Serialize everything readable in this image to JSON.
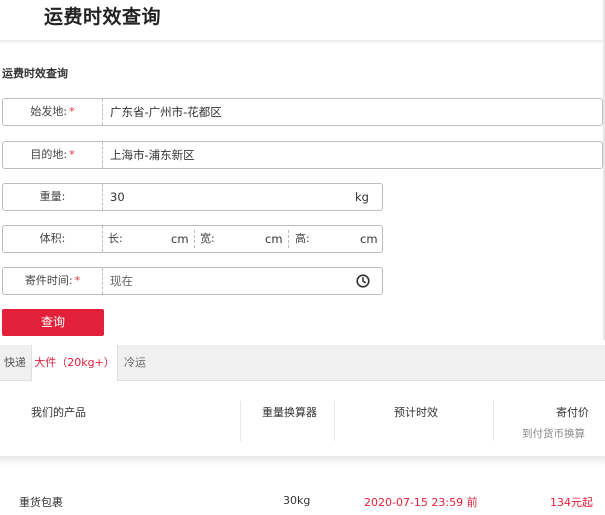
{
  "page": {
    "title": "运费时效查询"
  },
  "form": {
    "section_title": "运费时效查询",
    "origin": {
      "label": "始发地:",
      "required_mark": "*",
      "value": "广东省-广州市-花都区"
    },
    "destination": {
      "label": "目的地:",
      "required_mark": "*",
      "value": "上海市-浦东新区"
    },
    "weight": {
      "label": "重量:",
      "value": "30",
      "unit": "kg"
    },
    "volume": {
      "label": "体积:",
      "length_label": "长:",
      "length_unit": "cm",
      "width_label": "宽:",
      "width_unit": "cm",
      "height_label": "高:",
      "height_unit": "cm"
    },
    "send_time": {
      "label": "寄件时间:",
      "required_mark": "*",
      "value": "现在",
      "icon": "clock-icon"
    },
    "submit_label": "查询"
  },
  "tabs": [
    {
      "label": "快递",
      "active": false
    },
    {
      "label": "大件（20kg+）",
      "active": true
    },
    {
      "label": "冷运",
      "active": false
    }
  ],
  "table": {
    "headers": {
      "product": "我们的产品",
      "converter": "重量换算器",
      "eta": "预计时效",
      "price": "寄付价",
      "price_sub": "到付货币换算"
    },
    "rows": [
      {
        "product": "重货包裹",
        "weight": "30kg",
        "eta": "2020-07-15 23:59 前",
        "price": "134元起"
      }
    ]
  },
  "colors": {
    "accent": "#e3203a",
    "border": "#bdbdbd",
    "tab_bar": "#f0f0f0"
  }
}
